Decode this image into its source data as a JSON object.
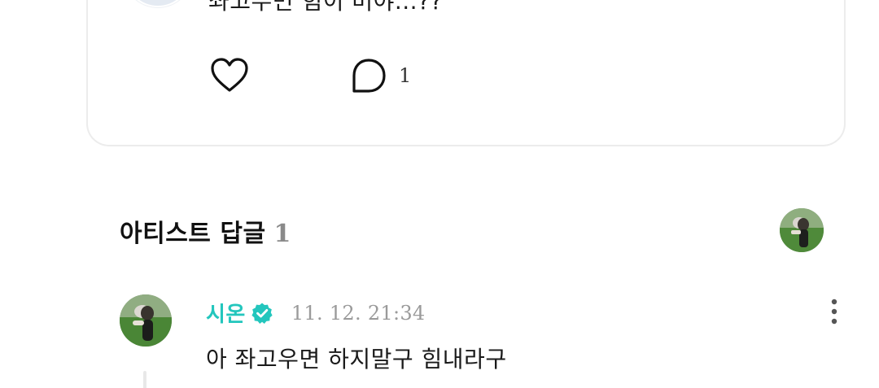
{
  "post": {
    "text": "좌고우면 힘이 머야...??",
    "comment_count": "1"
  },
  "artist_replies": {
    "title": "아티스트 답글",
    "count": "1"
  },
  "reply": {
    "author": "시온",
    "time": "11. 12. 21:34",
    "text": "아 좌고우면 하지말구 힘내라구"
  },
  "colors": {
    "author_accent": "#23c6bd",
    "verified_badge": "#23c6bd",
    "muted_text": "#9a9a9a",
    "card_border": "#ececec"
  },
  "icons": {
    "like": "heart-icon",
    "comment": "speech-bubble-icon",
    "verified": "verified-badge-icon",
    "more": "more-vertical-icon"
  }
}
